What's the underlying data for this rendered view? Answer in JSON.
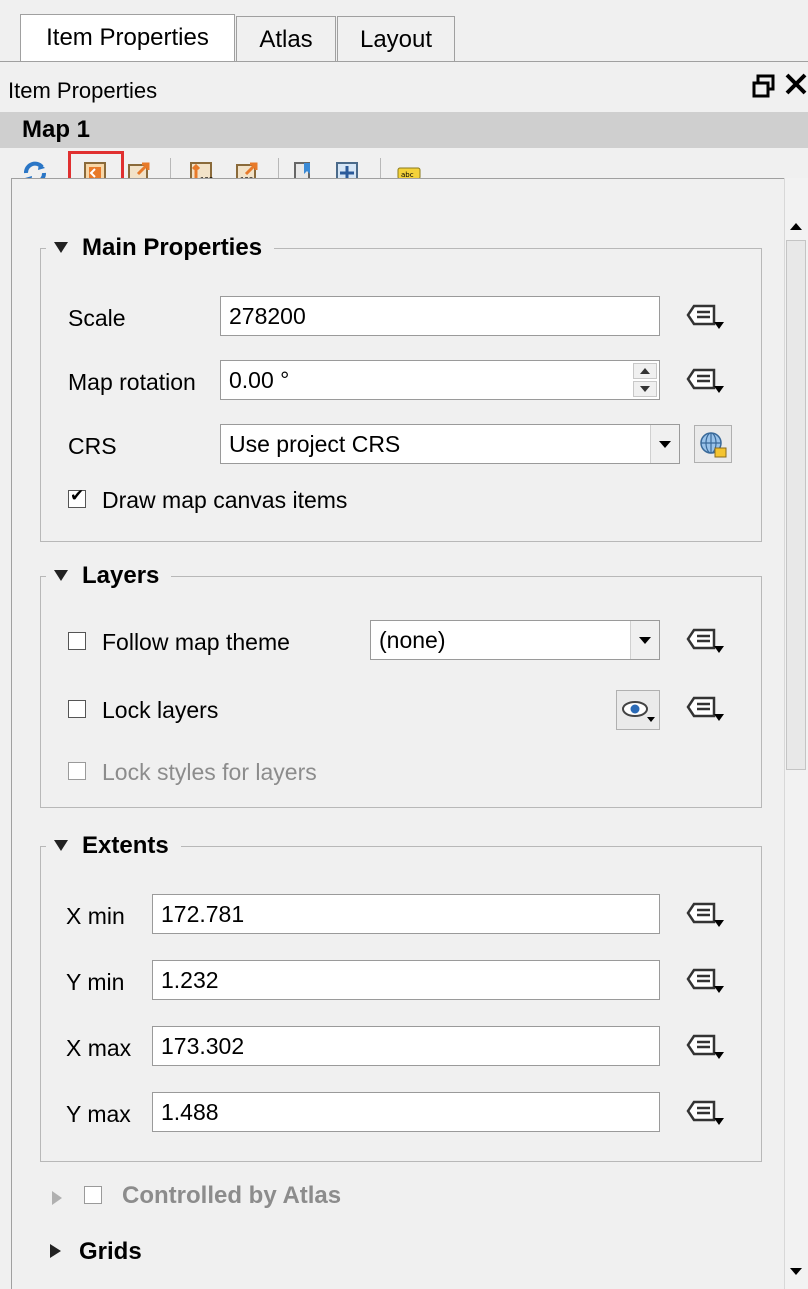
{
  "tabs": [
    {
      "label": "Item Properties",
      "active": true
    },
    {
      "label": "Atlas",
      "active": false
    },
    {
      "label": "Layout",
      "active": false
    }
  ],
  "dock": {
    "title": "Item Properties",
    "float_icon": "float-icon",
    "close_icon": "close-icon"
  },
  "item": {
    "name": "Map 1"
  },
  "toolbar": {
    "icons": [
      "refresh-icon",
      "set-extent-to-canvas-icon",
      "view-extent-in-canvas-icon",
      "set-scale-to-canvas-icon",
      "set-canvas-scale-icon",
      "bookmark-icon",
      "zoom-to-feature-icon",
      "label-settings-icon"
    ],
    "highlighted": "set-extent-to-canvas-icon",
    "highlight_color": "#e03030"
  },
  "main_properties": {
    "heading": "Main Properties",
    "scale_label": "Scale",
    "scale_value": "278200",
    "rotation_label": "Map rotation",
    "rotation_value": "0.00 °",
    "crs_label": "CRS",
    "crs_value": "Use project CRS",
    "draw_canvas_label": "Draw map canvas items",
    "draw_canvas_checked": true
  },
  "layers": {
    "heading": "Layers",
    "follow_theme_label": "Follow map theme",
    "follow_theme_checked": false,
    "theme_value": "(none)",
    "lock_layers_label": "Lock layers",
    "lock_layers_checked": false,
    "lock_styles_label": "Lock styles for layers",
    "lock_styles_checked": false
  },
  "extents": {
    "heading": "Extents",
    "xmin_label": "X min",
    "xmin_value": "172.781",
    "ymin_label": "Y min",
    "ymin_value": "1.232",
    "xmax_label": "X max",
    "xmax_value": "173.302",
    "ymax_label": "Y max",
    "ymax_value": "1.488"
  },
  "atlas": {
    "label": "Controlled by Atlas",
    "checked": false
  },
  "grids": {
    "label": "Grids"
  }
}
